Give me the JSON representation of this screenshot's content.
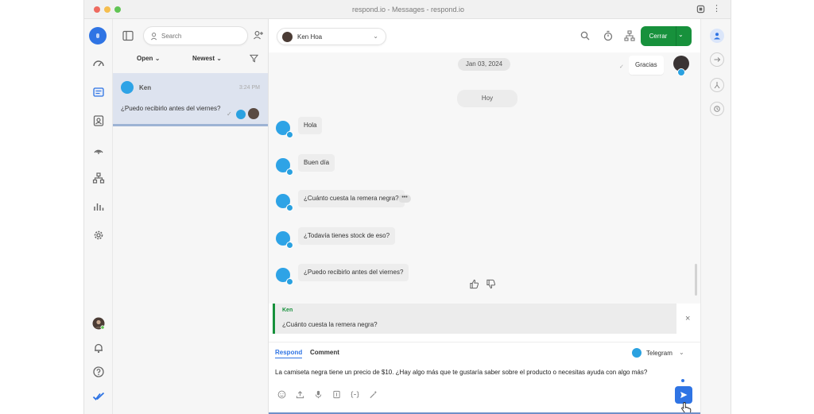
{
  "window": {
    "title": "respond.io - Messages - respond.io"
  },
  "search": {
    "placeholder": "Search"
  },
  "filters": {
    "status": "Open",
    "sort": "Newest"
  },
  "conversation": {
    "name": "Ken",
    "time": "3:24 PM",
    "preview": "¿Puedo recibirlo antes del viernes?",
    "check": "✓"
  },
  "chat_header": {
    "contact_name": "Ken Hoa",
    "close_label": "Cerrar",
    "chevron": "⌄"
  },
  "messages": {
    "date_old": "Jan 03, 2024",
    "date_today": "Hoy",
    "outgoing": {
      "text": "Gracias",
      "check": "✓"
    },
    "incoming": [
      {
        "text": "Hola"
      },
      {
        "text": "Buen día"
      },
      {
        "text": "¿Cuánto cuesta la remera negra?"
      },
      {
        "text": "¿Todavía tienes stock de eso?"
      },
      {
        "text": "¿Puedo recibirlo antes del viernes?"
      }
    ],
    "more": "•••"
  },
  "reply_quote": {
    "author": "Ken",
    "text": "¿Cuánto cuesta la remera negra?",
    "close": "×"
  },
  "composer": {
    "tab_respond": "Respond",
    "tab_comment": "Comment",
    "channel": "Telegram",
    "text": "La camiseta negra tiene un precio de $10. ¿Hay algo más que te gustaría saber sobre el producto o necesitas ayuda con algo más?"
  },
  "colors": {
    "accent_blue": "#2f74e4",
    "close_green": "#17913c",
    "telegram_blue": "#2aa1e0",
    "selected_row": "#dde3ef"
  }
}
